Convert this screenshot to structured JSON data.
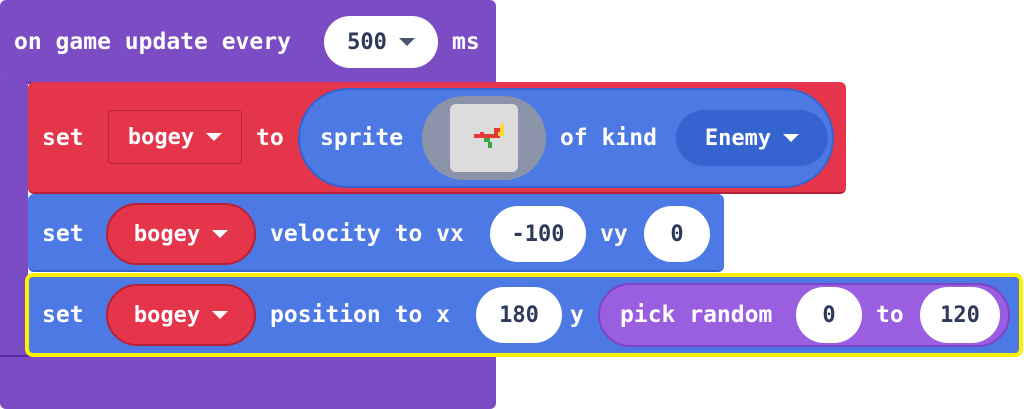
{
  "event_block": {
    "prefix": "on game update every",
    "interval_value": "500",
    "suffix": "ms",
    "colors": {
      "purple": "#7c4cc4",
      "purple_dark": "#5b2f9f"
    }
  },
  "stmt_sprite": {
    "set": "set",
    "var": "bogey",
    "to": "to",
    "sprite": "sprite",
    "of_kind": "of kind",
    "kind": "Enemy",
    "colors": {
      "red": "#e4354a",
      "blue": "#4c79e4",
      "kind_blue": "#3563cf"
    }
  },
  "stmt_velocity": {
    "set": "set",
    "var": "bogey",
    "velocity_to_vx": "velocity to vx",
    "vx": "-100",
    "vy_label": "vy",
    "vy": "0"
  },
  "stmt_position": {
    "set": "set",
    "var": "bogey",
    "position_to_x": "position to x",
    "x": "180",
    "y_label": "y",
    "pick_random": "pick random",
    "min": "0",
    "to": "to",
    "max": "120",
    "highlight_color": "#fff200"
  }
}
